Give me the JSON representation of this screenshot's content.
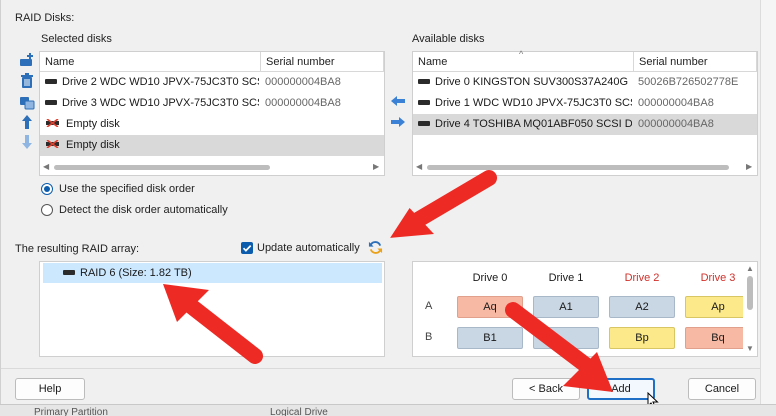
{
  "raid_disks_label": "RAID Disks:",
  "selected": {
    "title": "Selected disks",
    "col_name": "Name",
    "col_serial": "Serial number",
    "rows": [
      {
        "name": "Drive 2 WDC WD10 JPVX-75JC3T0 SCSI D...",
        "serial": "000000004BA8",
        "icon": "drive-icon",
        "selected": false
      },
      {
        "name": "Drive 3 WDC WD10 JPVX-75JC3T0 SCSI D...",
        "serial": "000000004BA8",
        "icon": "drive-icon",
        "selected": false
      },
      {
        "name": "Empty disk",
        "serial": "",
        "icon": "empty-disk-icon",
        "selected": false
      },
      {
        "name": "Empty disk",
        "serial": "",
        "icon": "empty-disk-icon",
        "selected": true
      }
    ]
  },
  "available": {
    "title": "Available disks",
    "col_name": "Name",
    "col_serial": "Serial number",
    "rows": [
      {
        "name": "Drive 0 KINGSTON SUV300S37A240G",
        "serial": "50026B726502778E",
        "selected": false
      },
      {
        "name": "Drive 1 WDC WD10 JPVX-75JC3T0 SCSI D...",
        "serial": "000000004BA8",
        "selected": false
      },
      {
        "name": "Drive 4 TOSHIBA MQ01ABF050 SCSI Disk...",
        "serial": "000000004BA8",
        "selected": true
      }
    ]
  },
  "order": {
    "specified": "Use the specified disk order",
    "detect": "Detect the disk order automatically",
    "selected": "specified"
  },
  "result": {
    "label": "The resulting RAID array:",
    "update_label": "Update automatically",
    "update_checked": true,
    "item": "RAID 6 (Size: 1.82 TB)"
  },
  "layout_grid": {
    "headers": [
      "Drive 0",
      "Drive 1",
      "Drive 2",
      "Drive 3"
    ],
    "header_colors": [
      "#1a1a1a",
      "#1a1a1a",
      "#d0302a",
      "#d0302a"
    ],
    "rows": [
      {
        "label": "A",
        "cells": [
          {
            "text": "Aq",
            "color": "salmon"
          },
          {
            "text": "A1",
            "color": "gray"
          },
          {
            "text": "A2",
            "color": "gray"
          },
          {
            "text": "Ap",
            "color": "yellow"
          }
        ]
      },
      {
        "label": "B",
        "cells": [
          {
            "text": "B1",
            "color": "gray"
          },
          {
            "text": "",
            "color": "gray"
          },
          {
            "text": "Bp",
            "color": "yellow"
          },
          {
            "text": "Bq",
            "color": "salmon"
          }
        ]
      }
    ]
  },
  "buttons": {
    "help": "Help",
    "back": "< Back",
    "add": "Add",
    "cancel": "Cancel"
  },
  "background": {
    "left_text": "Primary Partition",
    "right_text": "Logical Drive"
  },
  "colors": {
    "accent": "#0b5cad",
    "arrow_blue": "#3b82d6",
    "annotation_red": "#ee2a24",
    "selection": "#d9d9d9",
    "result_selection": "#cce8ff"
  }
}
